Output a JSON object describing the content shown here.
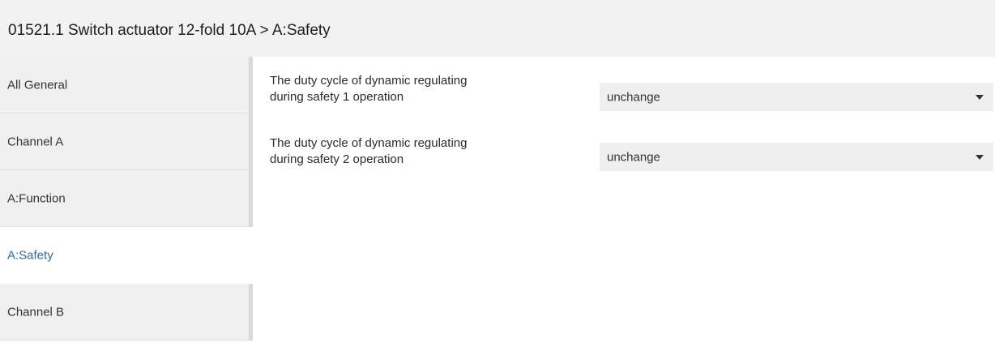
{
  "header": {
    "title": "01521.1 Switch actuator 12-fold 10A > A:Safety"
  },
  "sidebar": {
    "items": [
      {
        "label": "All General",
        "selected": false
      },
      {
        "label": "Channel A",
        "selected": false
      },
      {
        "label": "A:Function",
        "selected": false
      },
      {
        "label": "A:Safety",
        "selected": true
      },
      {
        "label": "Channel B",
        "selected": false
      }
    ]
  },
  "parameters": [
    {
      "label_line1": "The duty cycle of dynamic regulating",
      "label_line2": "during safety 1 operation",
      "value": "unchange",
      "arrow_icon": "chevron-down-icon"
    },
    {
      "label_line1": "The duty cycle of dynamic regulating",
      "label_line2": "during safety 2 operation",
      "value": "unchange",
      "arrow_icon": "chevron-down-icon"
    }
  ],
  "colors": {
    "selected_text": "#2a6bb2",
    "nav_background": "#f0f0f0",
    "header_background": "#f2f2f2",
    "dropdown_background": "#efefef"
  }
}
